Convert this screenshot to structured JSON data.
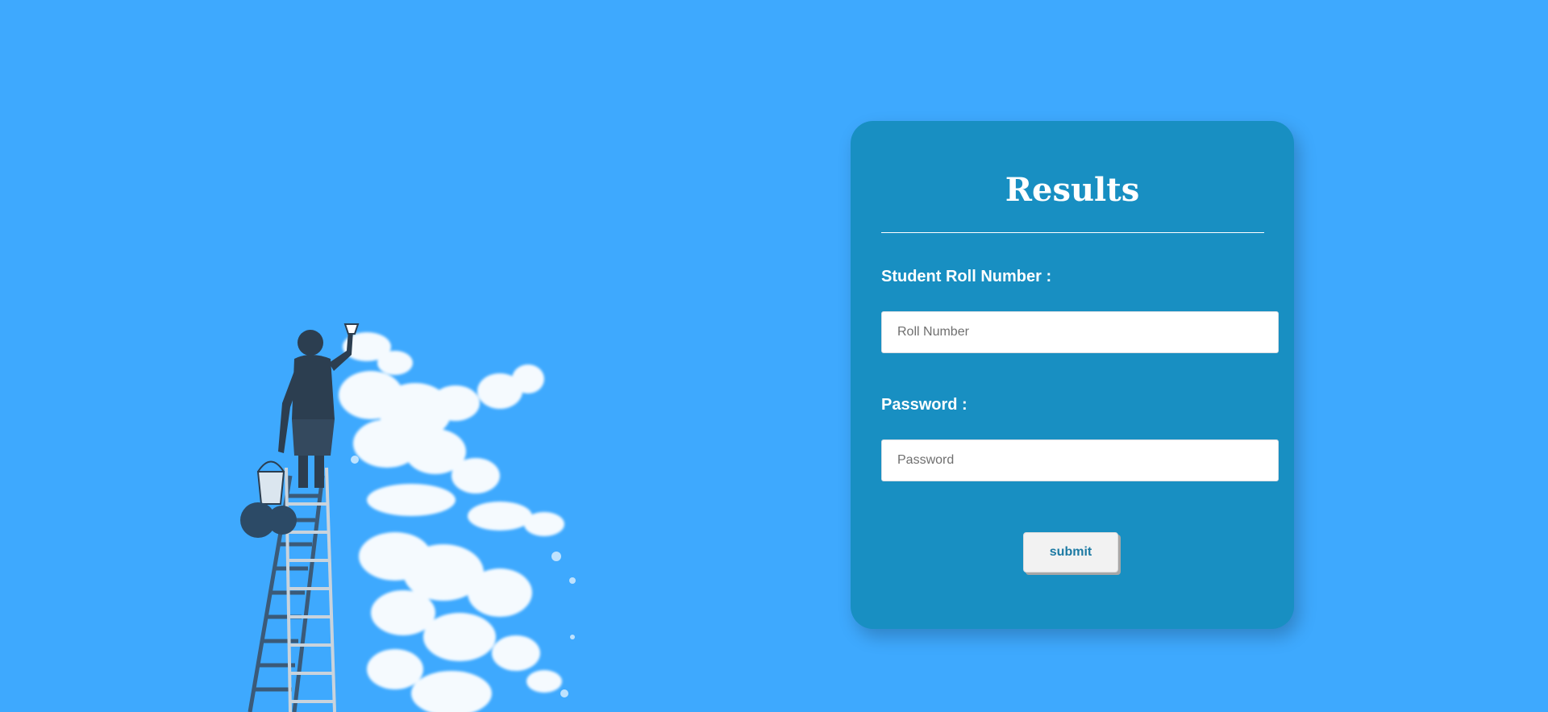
{
  "background_color": "#3ea9fe",
  "card_color": "#188fc2",
  "illustration": {
    "icon": "painter-on-ladder-painting-clouds-illustration"
  },
  "form": {
    "title": "Results",
    "roll_label": "Student Roll Number :",
    "roll_placeholder": "Roll Number",
    "roll_value": "",
    "password_label": "Password :",
    "password_placeholder": "Password",
    "password_value": "",
    "submit_label": "submit"
  }
}
